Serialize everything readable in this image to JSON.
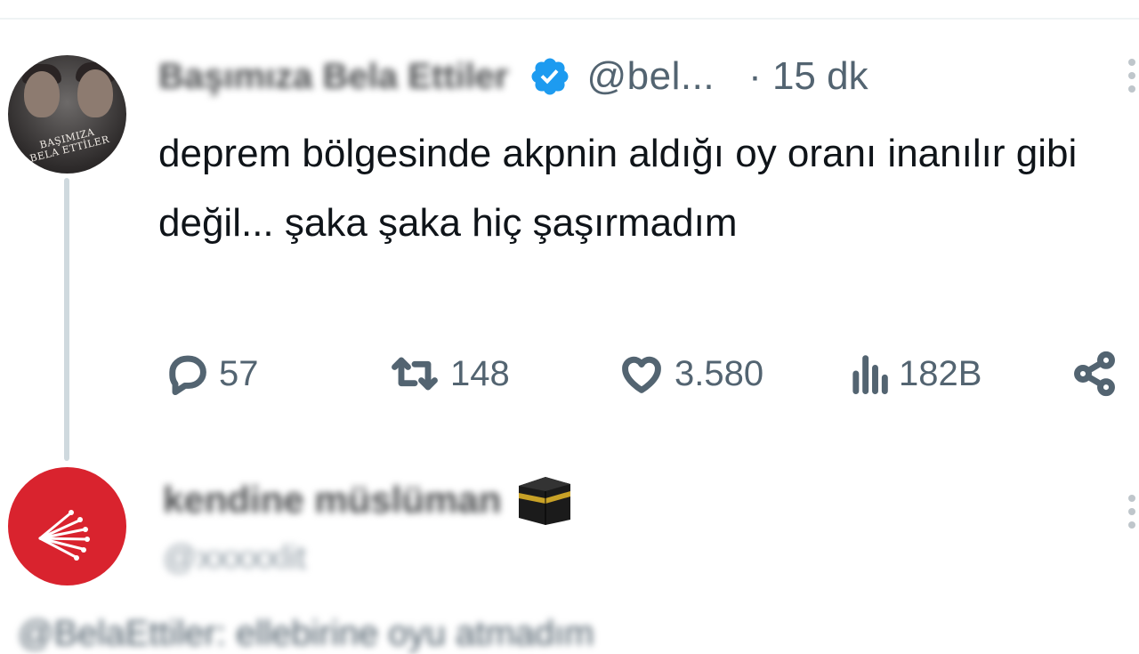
{
  "post": {
    "display_name": "Başımıza Bela Ettiler",
    "handle": "@bel...",
    "time": "· 15 dk",
    "avatar_text": "BAŞIMIZA BELA ETTİLER",
    "text": "deprem bölgesinde akpnin aldığı oy oranı inanılır gibi değil... şaka şaka hiç şaşırmadım",
    "stats": {
      "replies": "57",
      "retweets": "148",
      "likes": "3.580",
      "views": "182B"
    }
  },
  "reply": {
    "display_name": "kendine müslüman",
    "handle": "@xxxxxlit",
    "text_preview": "@BelaEttiler: ellebirine oyu atmadım"
  },
  "colors": {
    "text": "#0f1419",
    "secondary": "#536471",
    "verified": "#1d9bf0",
    "avatar_red": "#d9232e",
    "thread_line": "#cfd9de"
  },
  "icons": [
    "verified-badge-icon",
    "more-icon",
    "reply-icon",
    "retweet-icon",
    "like-icon",
    "views-icon",
    "share-icon",
    "kaaba-emoji-icon",
    "party-logo-icon"
  ]
}
